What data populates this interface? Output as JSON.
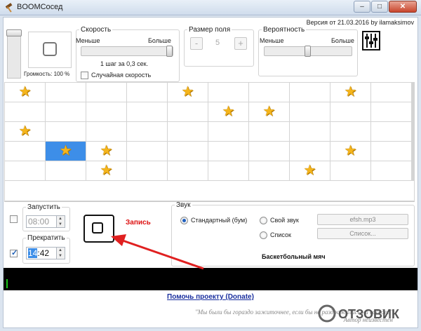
{
  "window": {
    "title": "BOOMСосед",
    "minimize": "–",
    "maximize": "□",
    "close": "✕"
  },
  "version": "Версия от 21.03.2016 by ilamaksimov",
  "volume": {
    "label": "Громкость: 100 %",
    "level_percent": 100
  },
  "speed": {
    "legend": "Скорость",
    "less": "Меньше",
    "more": "Больше",
    "value": "1 шаг за 0,3 сек.",
    "slider_fraction": 1.0,
    "random_label": "Случайная скорость",
    "random_checked": false
  },
  "field_size": {
    "legend": "Размер поля",
    "minus": "-",
    "value": "5",
    "plus": "+"
  },
  "probability": {
    "legend": "Вероятность",
    "less": "Меньше",
    "more": "Больше",
    "slider_fraction": 0.5
  },
  "settings_icon": "equalizer-icon",
  "grid": {
    "rows": 5,
    "cols": 10,
    "selected": [
      3,
      1
    ],
    "stars": [
      [
        0,
        0
      ],
      [
        0,
        4
      ],
      [
        0,
        8
      ],
      [
        1,
        5
      ],
      [
        1,
        6
      ],
      [
        2,
        0
      ],
      [
        3,
        1
      ],
      [
        3,
        2
      ],
      [
        3,
        8
      ],
      [
        4,
        2
      ],
      [
        4,
        7
      ]
    ]
  },
  "schedule": {
    "start_label": "Запустить",
    "start_time": "08:00",
    "start_checked": false,
    "stop_label": "Прекратить",
    "stop_time_hh": "14",
    "stop_time_rest": ":42",
    "stop_checked": true
  },
  "record": {
    "label": "Запись"
  },
  "sound": {
    "legend": "Звук",
    "standard": "Стандартный (бум)",
    "own": "Свой звук",
    "list": "Список",
    "selected": "standard",
    "file": "efsh.mp3",
    "list_button": "Список...",
    "current_name": "Баскетбольный мяч"
  },
  "donate": "Помочь проекту (Donate)",
  "quote": {
    "line1": "\"Мы были бы гораздо зажиточнее, если бы не раздражались на соседей\"",
    "line2": "Автор неизвестен"
  },
  "watermark": "ОТЗОВИК",
  "colors": {
    "record_red": "#d11111",
    "selection_blue": "#3d8ee8",
    "star_gold": "#f5b51b",
    "donate_link": "#1a2f9e"
  }
}
